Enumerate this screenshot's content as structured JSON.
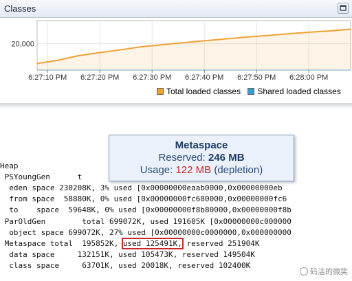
{
  "panel": {
    "title": "Classes"
  },
  "chart_data": {
    "type": "area",
    "title": "",
    "xlabel": "",
    "ylabel": "",
    "x_ticks": [
      "6:27:10 PM",
      "6:27:20 PM",
      "6:27:30 PM",
      "6:27:40 PM",
      "6:27:50 PM",
      "6:28:00 PM"
    ],
    "y_ticks": [
      {
        "label": "20,000",
        "value": 20000
      }
    ],
    "x_range": [
      "6:27:08 PM",
      "6:28:08 PM"
    ],
    "ylim": [
      0,
      37500
    ],
    "grid": true,
    "legend_position": "bottom-right",
    "x": [
      "6:27:08",
      "6:27:12",
      "6:27:16",
      "6:27:20",
      "6:27:24",
      "6:27:28",
      "6:27:32",
      "6:27:36",
      "6:27:40",
      "6:27:44",
      "6:27:48",
      "6:27:52",
      "6:27:56",
      "6:28:00",
      "6:28:04",
      "6:28:08"
    ],
    "series": [
      {
        "name": "Total loaded classes",
        "color": "#f0a030",
        "values": [
          5000,
          7500,
          11000,
          13200,
          15400,
          17700,
          19200,
          20800,
          22200,
          23600,
          25000,
          26200,
          27500,
          28700,
          29700,
          31000
        ]
      },
      {
        "name": "Shared loaded classes",
        "color": "#3a9bd0",
        "values": [
          0,
          0,
          0,
          0,
          0,
          0,
          0,
          0,
          0,
          0,
          0,
          0,
          0,
          0,
          0,
          0
        ]
      }
    ]
  },
  "tooltip": {
    "title": "Metaspace",
    "reserved_label": "Reserved: ",
    "reserved_value": "246 MB",
    "usage_label": "Usage: ",
    "usage_value": "122 MB",
    "usage_note": " (depletion)"
  },
  "console": {
    "heap": "Heap",
    "young_a": " PSYoungGen      t",
    "young_b": "                                                    00eaab0000",
    "eden_a": "  eden space 230208K, 3% used [0x00000000eaab0000,0x00000000eb",
    "from_a": "  from space  58880K, 0% used [0x00000000fc680000,0x00000000fc6",
    "to_a": "  to    space  59648K, 0% used [0x00000000f8b80000,0x00000000f8b",
    "old_a": " ParOldGen        total 699072K, used 191605K [0x00000000c000000",
    "object_a": "  object space 699072K, 27% used [0x00000000c0000000,0x000000000",
    "meta_pre": " Metaspace total  195852K, ",
    "meta_used": "used 125491K,",
    "meta_post": " reserved 251904K",
    "data_a": "  data space     132151K, used 105473K, reserved 149504K",
    "class_a": "  class space     63701K, used 20018K, reserved 102400K"
  },
  "watermark": {
    "text": "码洁的微笑"
  }
}
